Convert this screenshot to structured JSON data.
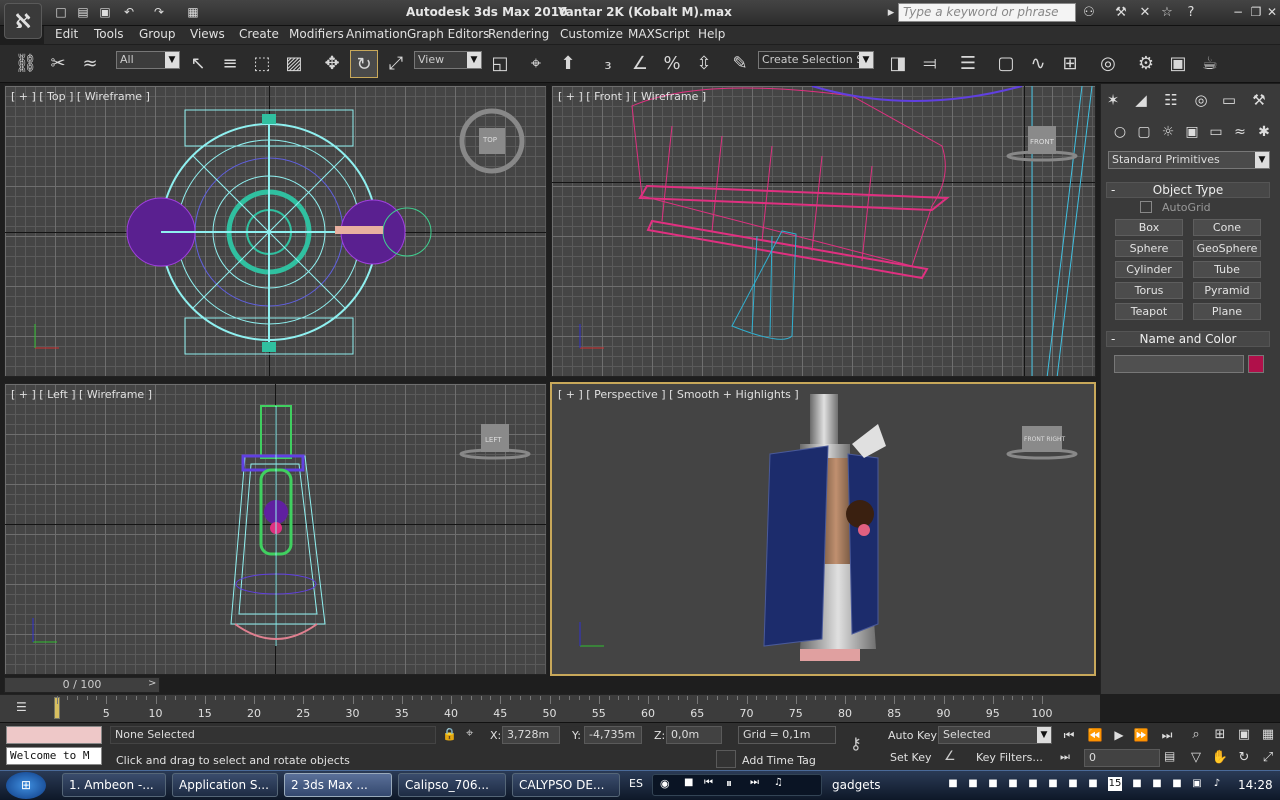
{
  "window": {
    "app_title": "Autodesk 3ds Max  2010",
    "file_title": "Yantar 2K (Kobalt M).max",
    "search_placeholder": "Type a keyword or phrase"
  },
  "menu": [
    "Edit",
    "Tools",
    "Group",
    "Views",
    "Create",
    "Modifiers",
    "Animation",
    "Graph Editors",
    "Rendering",
    "Customize",
    "MAXScript",
    "Help"
  ],
  "toolbar": {
    "selection_filter": "All",
    "reference_coord": "View",
    "named_selection": "Create Selection Se"
  },
  "viewports": {
    "top": "[ + ] [ Top ] [ Wireframe ]",
    "front": "[ + ] [ Front ] [ Wireframe ]",
    "left": "[ + ] [ Left ] [ Wireframe ]",
    "perspective": "[ + ] [ Perspective ] [ Smooth + Highlights ]",
    "viewcube_top": "TOP",
    "viewcube_front": "FRONT",
    "viewcube_left": "LEFT",
    "viewcube_persp": "FRONT  RIGHT"
  },
  "command_panel": {
    "category": "Standard Primitives",
    "object_type_title": "Object Type",
    "autogrid": "AutoGrid",
    "primitives": [
      "Box",
      "Cone",
      "Sphere",
      "GeoSphere",
      "Cylinder",
      "Tube",
      "Torus",
      "Pyramid",
      "Teapot",
      "Plane"
    ],
    "name_color_title": "Name and Color",
    "object_color": "#b0104a"
  },
  "timeline": {
    "frame_display": "0 / 100",
    "ticks": [
      "5",
      "10",
      "15",
      "20",
      "25",
      "30",
      "35",
      "40",
      "45",
      "50",
      "55",
      "60",
      "65",
      "70",
      "75",
      "80",
      "85",
      "90",
      "95",
      "100"
    ]
  },
  "status": {
    "maxscript_line": "Welcome to M",
    "selection": "None Selected",
    "prompt": "Click and drag to select and rotate objects",
    "x_label": "X:",
    "x_value": "3,728m",
    "y_label": "Y:",
    "y_value": "-4,735m",
    "z_label": "Z:",
    "z_value": "0,0m",
    "grid": "Grid = 0,1m",
    "add_time_tag": "Add Time Tag",
    "auto_key": "Auto Key",
    "set_key": "Set Key",
    "key_mode": "Selected",
    "key_filters": "Key Filters...",
    "current_frame": "0"
  },
  "taskbar": {
    "tasks": [
      "1. Ambeon -...",
      "Application S...",
      "2 3ds Max ...",
      "Calipso_706...",
      "CALYPSO DE..."
    ],
    "active_task_index": 2,
    "language": "ES",
    "media_label": "gadgets",
    "clock": "14:28",
    "tray_date": "15"
  }
}
